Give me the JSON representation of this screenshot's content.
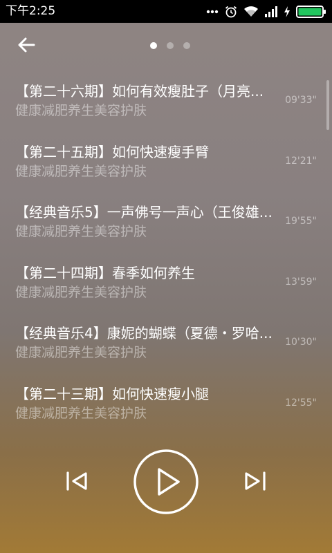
{
  "status_bar": {
    "time": "下午2:25",
    "icons": [
      "more-dots-icon",
      "alarm-icon",
      "wifi-icon",
      "signal-icon",
      "charging-icon",
      "battery-icon"
    ]
  },
  "header": {
    "back_icon": "back-arrow-icon",
    "pages_total": 3,
    "current_page": 1
  },
  "tracks": [
    {
      "title": "【第二十六期】如何有效瘦肚子（月亮...",
      "subtitle": "健康减肥养生美容护肤",
      "duration": "09'33\""
    },
    {
      "title": "【第二十五期】如何快速瘦手臂",
      "subtitle": "健康减肥养生美容护肤",
      "duration": "12'21\""
    },
    {
      "title": "【经典音乐5】一声佛号一声心（王俊雄...",
      "subtitle": "健康减肥养生美容护肤",
      "duration": "19'55\""
    },
    {
      "title": "【第二十四期】春季如何养生",
      "subtitle": "健康减肥养生美容护肤",
      "duration": "13'59\""
    },
    {
      "title": "【经典音乐4】康妮的蝴蝶（夏德・罗哈...",
      "subtitle": "健康减肥养生美容护肤",
      "duration": "10'30\""
    },
    {
      "title": "【第二十三期】如何快速瘦小腿",
      "subtitle": "健康减肥养生美容护肤",
      "duration": "12'55\""
    }
  ],
  "controls": {
    "previous_icon": "skip-previous-icon",
    "play_icon": "play-icon",
    "next_icon": "skip-next-icon"
  },
  "colors": {
    "accent_battery": "#22c55e",
    "background_top": "#8f8583",
    "background_bottom": "#a27a36"
  }
}
